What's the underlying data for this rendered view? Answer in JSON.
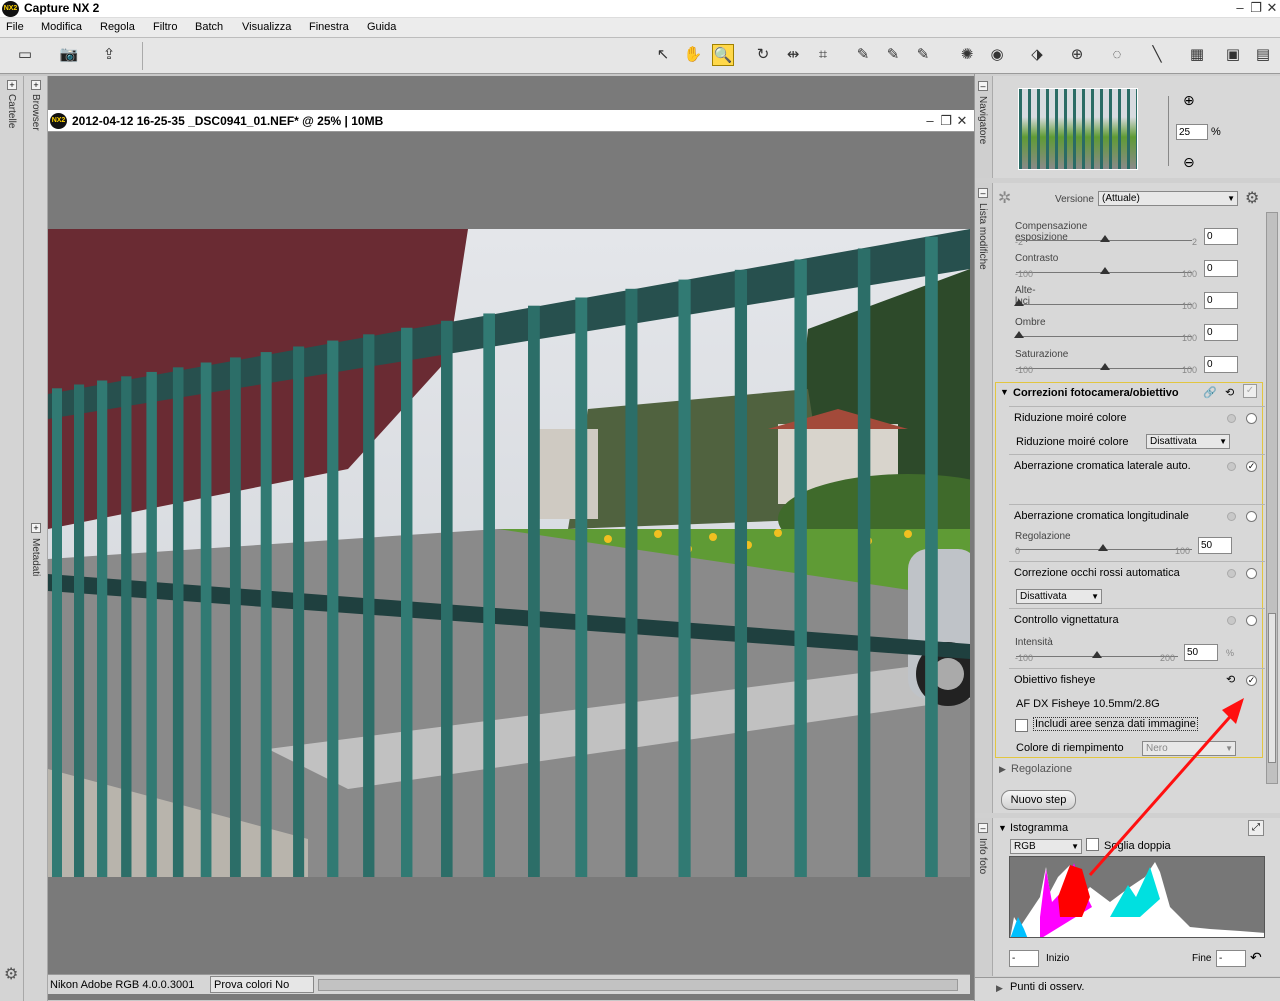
{
  "app": {
    "title": "Capture NX 2",
    "logo_text": "NX2"
  },
  "menu": [
    "File",
    "Modifica",
    "Regola",
    "Filtro",
    "Batch",
    "Visualizza",
    "Finestra",
    "Guida"
  ],
  "left_rail": {
    "top_label": "Cartelle",
    "browser_label": "Browser",
    "metadata_label": "Metadati"
  },
  "document": {
    "title": "2012-04-12  16-25-35  _DSC0941_01.NEF* @ 25%  |  10MB"
  },
  "status": {
    "profile": "Nikon Adobe RGB 4.0.0.3001",
    "proof": "Prova colori No"
  },
  "navigator": {
    "label": "Navigatore",
    "zoom_value": "25",
    "zoom_unit": "%"
  },
  "edit_list": {
    "label": "Lista modifiche",
    "version_label": "Versione",
    "version_value": "(Attuale)",
    "sliders": [
      {
        "label": "Compensazione esposizione",
        "min": "-2",
        "max": "2",
        "value": "0"
      },
      {
        "label": "Contrasto",
        "min": "-100",
        "max": "100",
        "value": "0"
      },
      {
        "label": "Alte-luci",
        "min": "",
        "max": "100",
        "value": "0"
      },
      {
        "label": "Ombre",
        "min": "",
        "max": "100",
        "value": "0"
      },
      {
        "label": "Saturazione",
        "min": "-100",
        "max": "100",
        "value": "0"
      }
    ],
    "camera_section": {
      "title": "Correzioni fotocamera/obiettivo",
      "moire_title": "Riduzione moiré colore",
      "moire_label": "Riduzione moiré colore",
      "moire_value": "Disattivata",
      "lateral_ca": "Aberrazione cromatica laterale auto.",
      "longitudinal_ca": "Aberrazione cromatica longitudinale",
      "regolazione_label": "Regolazione",
      "reg_min": "0",
      "reg_max": "100",
      "reg_value": "50",
      "redeye": "Correzione occhi rossi automatica",
      "redeye_value": "Disattivata",
      "vignette": "Controllo vignettatura",
      "intensity_label": "Intensità",
      "int_min": "-100",
      "int_max": "200",
      "int_value": "50",
      "int_unit": "%",
      "fisheye": "Obiettivo fisheye",
      "fisheye_lens": "AF DX Fisheye 10.5mm/2.8G",
      "include_areas": "Includi aree senza dati immagine",
      "fill_color_label": "Colore di riempimento",
      "fill_color_value": "Nero"
    },
    "regolazione_section": "Regolazione",
    "new_step": "Nuovo step"
  },
  "histogram": {
    "label": "Info foto",
    "title": "Istogramma",
    "channel": "RGB",
    "double_threshold": "Soglia doppia",
    "start_label": "Inizio",
    "end_label": "Fine",
    "start_value": "-",
    "end_value": "-"
  },
  "points": {
    "title": "Punti di osserv."
  }
}
